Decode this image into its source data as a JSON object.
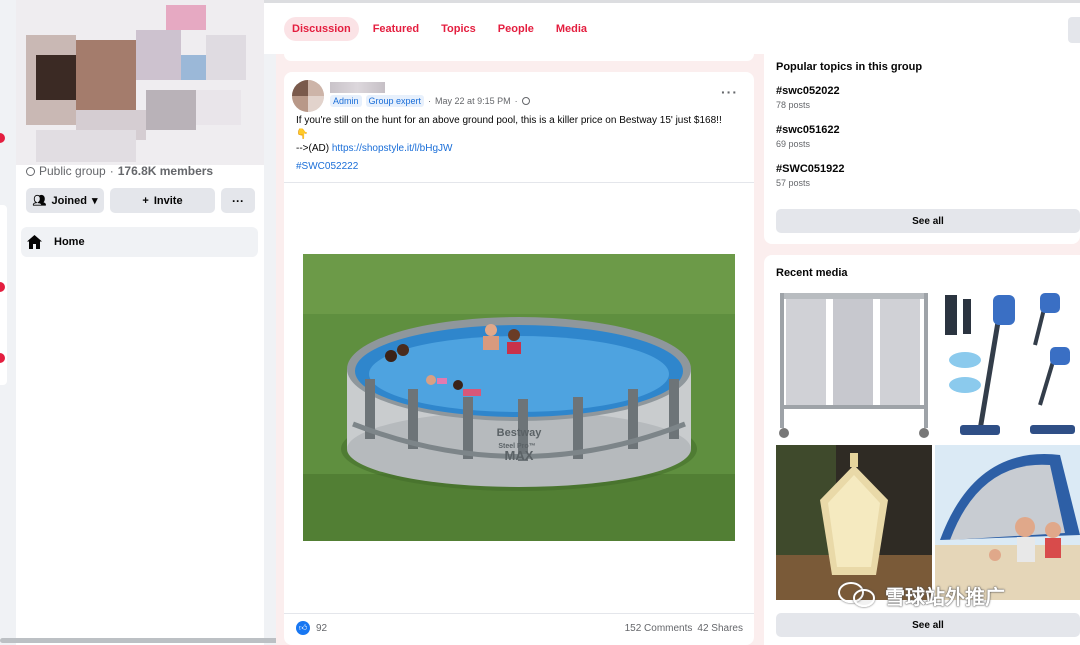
{
  "sidebar": {
    "group_type": "Public group",
    "members": "176.8K members",
    "separator": "·",
    "joined_label": "Joined",
    "invite_label": "Invite",
    "more_label": "···",
    "nav_home_label": "Home"
  },
  "tabs": [
    "Discussion",
    "Featured",
    "Topics",
    "People",
    "Media"
  ],
  "post": {
    "badge_admin": "Admin",
    "badge_expert": "Group expert",
    "date": "May 22 at 9:15 PM",
    "dot": "·",
    "text_line1": "If you're still on the hunt for an above ground pool, this is a killer price on Bestway 15' just $168!!",
    "emoji": "👇",
    "ad_prefix": "-->(AD) ",
    "link": "https://shopstyle.it/l/bHgJW",
    "hashtag": "#SWC052222",
    "image_brand": "Bestway",
    "image_line": "Steel Pro™",
    "image_model": "MAX",
    "likes": "92",
    "comments": "152 Comments",
    "shares": "42 Shares",
    "more": "···"
  },
  "topics_card": {
    "title": "Popular topics in this group",
    "topics": [
      {
        "tag": "#swc052022",
        "count": "78 posts"
      },
      {
        "tag": "#swc051622",
        "count": "69 posts"
      },
      {
        "tag": "#SWC051922",
        "count": "57 posts"
      }
    ],
    "see_all": "See all"
  },
  "media_card": {
    "title": "Recent media",
    "see_all": "See all"
  },
  "watermark": "雪球站外推广",
  "colors": {
    "accent_red": "#e41e3f",
    "link_blue": "#1a6ed8",
    "like_blue": "#1877f2",
    "bg_gray": "#f0f2f5"
  }
}
